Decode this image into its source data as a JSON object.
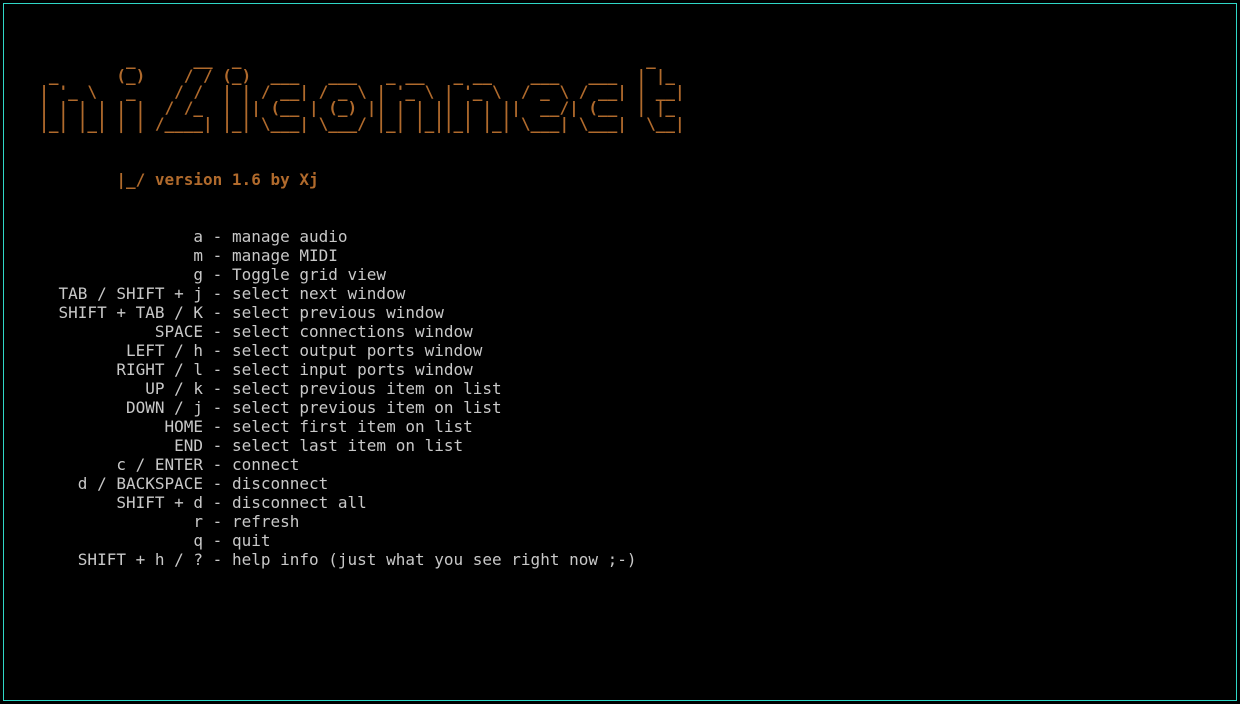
{
  "logo_ascii": "           _      __  _                                          _    \n   _      (_)    / / (_)  ___   ___   _ __   _ __    ___   ___  | |_  \n  | '_ \\   _    / /  | | / __| / _ \\ | '_ \\ | '_ \\  / _ \\ / __| | __| \n  | | | | | |  / /_  | || (__ | (_) || | | || | | ||  __/| (__  | |_  \n  |_| |_| | | /____| |_| \\___| \\___/ |_| |_||_| |_| \\___| \\___|  \\__| ",
  "version_line": "          |_/ version 1.6 by Xj",
  "key_col_width": 19,
  "help": [
    {
      "key": "a",
      "desc": "manage audio"
    },
    {
      "key": "m",
      "desc": "manage MIDI"
    },
    {
      "key": "g",
      "desc": "Toggle grid view"
    },
    {
      "key": "TAB / SHIFT + j",
      "desc": "select next window"
    },
    {
      "key": "SHIFT + TAB / K",
      "desc": "select previous window"
    },
    {
      "key": "SPACE",
      "desc": "select connections window"
    },
    {
      "key": "LEFT / h",
      "desc": "select output ports window"
    },
    {
      "key": "RIGHT / l",
      "desc": "select input ports window"
    },
    {
      "key": "UP / k",
      "desc": "select previous item on list"
    },
    {
      "key": "DOWN / j",
      "desc": "select previous item on list"
    },
    {
      "key": "HOME",
      "desc": "select first item on list"
    },
    {
      "key": "END",
      "desc": "select last item on list"
    },
    {
      "key": "c / ENTER",
      "desc": "connect"
    },
    {
      "key": "d / BACKSPACE",
      "desc": "disconnect"
    },
    {
      "key": "SHIFT + d",
      "desc": "disconnect all"
    },
    {
      "key": "r",
      "desc": "refresh"
    },
    {
      "key": "q",
      "desc": "quit"
    },
    {
      "key": "SHIFT + h / ?",
      "desc": "help info (just what you see right now ;-)"
    }
  ]
}
